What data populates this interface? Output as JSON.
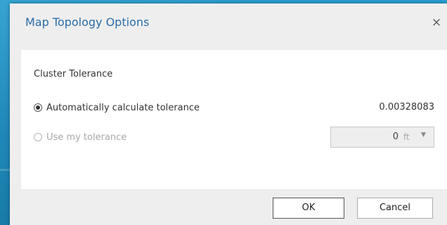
{
  "dialog": {
    "title": "Map Topology Options",
    "close_icon": "close-icon",
    "close_glyph": "×"
  },
  "cluster_tolerance": {
    "section_label": "Cluster Tolerance",
    "auto_option": {
      "label": "Automatically calculate tolerance",
      "selected": true,
      "value": "0.00328083"
    },
    "custom_option": {
      "label": "Use my tolerance",
      "selected": false,
      "enabled": false,
      "value": "0",
      "unit": "ft",
      "unit_dropdown_icon": "chevron-down-icon",
      "chevron_glyph": "▼"
    }
  },
  "buttons": {
    "ok_label": "OK",
    "cancel_label": "Cancel"
  },
  "colors": {
    "title_text": "#2b6ca8",
    "desktop_background": "#1e8fc0",
    "disabled_text": "#a8a8a8"
  }
}
